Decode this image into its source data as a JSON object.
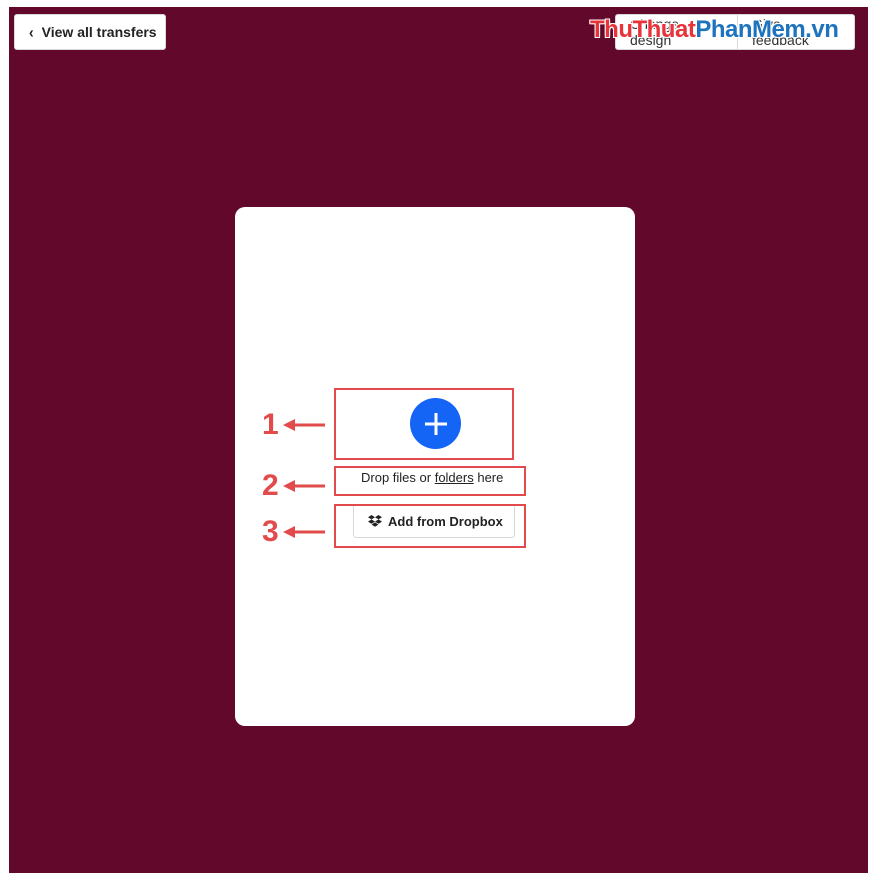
{
  "header": {
    "back_label": "View all transfers",
    "change_design_label": "Change design",
    "feedback_label": "Give feedback"
  },
  "watermark": {
    "part1": "Thu",
    "part2": "Thuat",
    "part3": "PhanMem",
    "part4": ".vn"
  },
  "upload": {
    "drop_text_before": "Drop files or ",
    "drop_text_link": "folders",
    "drop_text_after": " here",
    "dropbox_label": "Add from Dropbox"
  },
  "annotations": {
    "labels": [
      "1",
      "2",
      "3"
    ],
    "color": "#e24b4b"
  },
  "colors": {
    "background": "#61082b",
    "accent": "#1464f6",
    "card": "#ffffff"
  },
  "icons": {
    "back": "chevron-left-icon",
    "add": "plus-icon",
    "dropbox": "dropbox-icon",
    "arrow": "arrow-left-icon"
  }
}
